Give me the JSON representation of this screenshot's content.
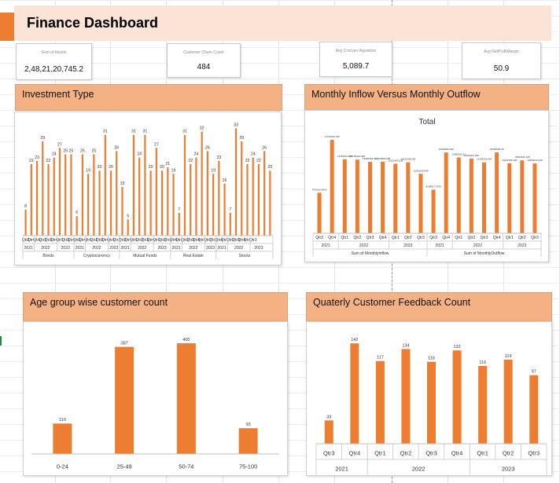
{
  "dashboard": {
    "title": "Finance Dashboard"
  },
  "kpis": [
    {
      "label": "Sum of Assets",
      "value": "2,48,21,20,745.2"
    },
    {
      "label": "Customer Churn Count",
      "value": "484"
    },
    {
      "label": "Avg Cost per Aquisition",
      "value": "5,089.7"
    },
    {
      "label": "Avg NetProfitMargin",
      "value": "50.9"
    }
  ],
  "sections": {
    "investment": "Investment Type",
    "inflow": "Monthly Inflow Versus Monthly Outflow",
    "age": "Age group wise customer count",
    "feedback": "Quaterly Customer Feedback Count"
  },
  "chart_data": [
    {
      "type": "bar",
      "title": "",
      "categories": [
        "Qtr3",
        "Qtr4",
        "Qtr1",
        "Qtr2",
        "Qtr3",
        "Qtr4",
        "Qtr1",
        "Qtr3",
        "Qtr4",
        "Qtr3",
        "Qtr4",
        "Qtr1",
        "Qtr2",
        "Qtr3",
        "Qtr4",
        "Qtr1",
        "Qtr2",
        "Qtr3",
        "Qtr4",
        "Qtr1",
        "Qtr2",
        "Qtr3",
        "Qtr4",
        "Qtr1",
        "Qtr2",
        "Qtr3",
        "Qtr4",
        "Qtr1",
        "Qtr2",
        "Qtr3",
        "Qtr4",
        "Qtr1",
        "Qtr2",
        "Qtr3",
        "Qtr4",
        "Qtr1",
        "Qtr2",
        "Qtr3",
        "Qtr4",
        "Qtr1",
        "Qtr3"
      ],
      "values": [
        8,
        22,
        23,
        29,
        22,
        24,
        27,
        25,
        25,
        6,
        25,
        19,
        25,
        20,
        31,
        20,
        26,
        15,
        5,
        31,
        24,
        31,
        20,
        27,
        20,
        21,
        19,
        7,
        31,
        22,
        24,
        32,
        26,
        19,
        23,
        16,
        7,
        33,
        29,
        22,
        24,
        22,
        26,
        20
      ],
      "year_groups": [
        {
          "label": "2021",
          "span": 2
        },
        {
          "label": "2022",
          "span": 4
        },
        {
          "label": "2023",
          "span": 3
        },
        {
          "label": "2021",
          "span": 2
        },
        {
          "label": "2022",
          "span": 4
        },
        {
          "label": "2023",
          "span": 2
        },
        {
          "label": "2021",
          "span": 2
        },
        {
          "label": "2022",
          "span": 4
        },
        {
          "label": "2023",
          "span": 3
        },
        {
          "label": "2021",
          "span": 2
        },
        {
          "label": "2022",
          "span": 4
        },
        {
          "label": "2023",
          "span": 2
        },
        {
          "label": "2021",
          "span": 2
        },
        {
          "label": "2022",
          "span": 4
        },
        {
          "label": "2023",
          "span": 3
        }
      ],
      "groups": [
        {
          "label": "Bonds",
          "span": 9
        },
        {
          "label": "Cryptocurrency",
          "span": 8
        },
        {
          "label": "Mutual Funds",
          "span": 9
        },
        {
          "label": "Real Estate",
          "span": 8
        },
        {
          "label": "Stocks",
          "span": 10
        }
      ],
      "ylim": [
        0,
        36
      ]
    },
    {
      "type": "bar",
      "title": "Total",
      "categories": [
        "Qtr3",
        "Qtr4",
        "Qtr1",
        "Qtr2",
        "Qtr3",
        "Qtr4",
        "Qtr1",
        "Qtr2",
        "Qtr3",
        "Qtr3",
        "Qtr4",
        "Qtr1",
        "Qtr2",
        "Qtr3",
        "Qtr4",
        "Qtr1",
        "Qtr2",
        "Qtr3"
      ],
      "values": [
        7541116,
        17370916,
        13766514,
        13709324,
        13281563,
        13329904,
        12932443,
        13211340,
        11062166,
        8108817,
        15036556,
        14093541,
        13901911,
        13193231,
        15050665,
        13026155,
        13566101,
        12994012
      ],
      "data_labels": [
        "7541116.8020",
        "17370916.335",
        "13766514.888",
        "13709324.028",
        "13281563.034",
        "13329904.028",
        "12932443.028",
        "13211340.028",
        "11062166.808",
        "8108817.0730",
        "15036556.028",
        "14093541.21",
        "13901911.035",
        "13193231.034",
        "15050665.08",
        "13026155.328",
        "13566101.428",
        "12994012.028"
      ],
      "year_groups": [
        {
          "label": "2021",
          "span": 2
        },
        {
          "label": "2022",
          "span": 4
        },
        {
          "label": "2023",
          "span": 3
        },
        {
          "label": "2021",
          "span": 2
        },
        {
          "label": "2022",
          "span": 4
        },
        {
          "label": "2023",
          "span": 3
        }
      ],
      "groups": [
        {
          "label": "Sum of MonthlyInflow",
          "span": 9
        },
        {
          "label": "Sum of MonthlyOutflow",
          "span": 9
        }
      ],
      "ylim": [
        0,
        19000000
      ]
    },
    {
      "type": "bar",
      "title": "",
      "categories": [
        "0-24",
        "25-49",
        "50-74",
        "75-100"
      ],
      "values": [
        110,
        387,
        400,
        93
      ],
      "ylim": [
        0,
        420
      ]
    },
    {
      "type": "bar",
      "title": "",
      "categories": [
        "Qtr3",
        "Qtr4",
        "Qtr1",
        "Qtr2",
        "Qtr3",
        "Qtr4",
        "Qtr1",
        "Qtr2",
        "Qtr3"
      ],
      "values": [
        33,
        142,
        117,
        134,
        116,
        132,
        110,
        119,
        97
      ],
      "year_groups": [
        {
          "label": "2021",
          "span": 2
        },
        {
          "label": "2022",
          "span": 4
        },
        {
          "label": "2023",
          "span": 3
        }
      ],
      "ylim": [
        0,
        150
      ]
    }
  ]
}
